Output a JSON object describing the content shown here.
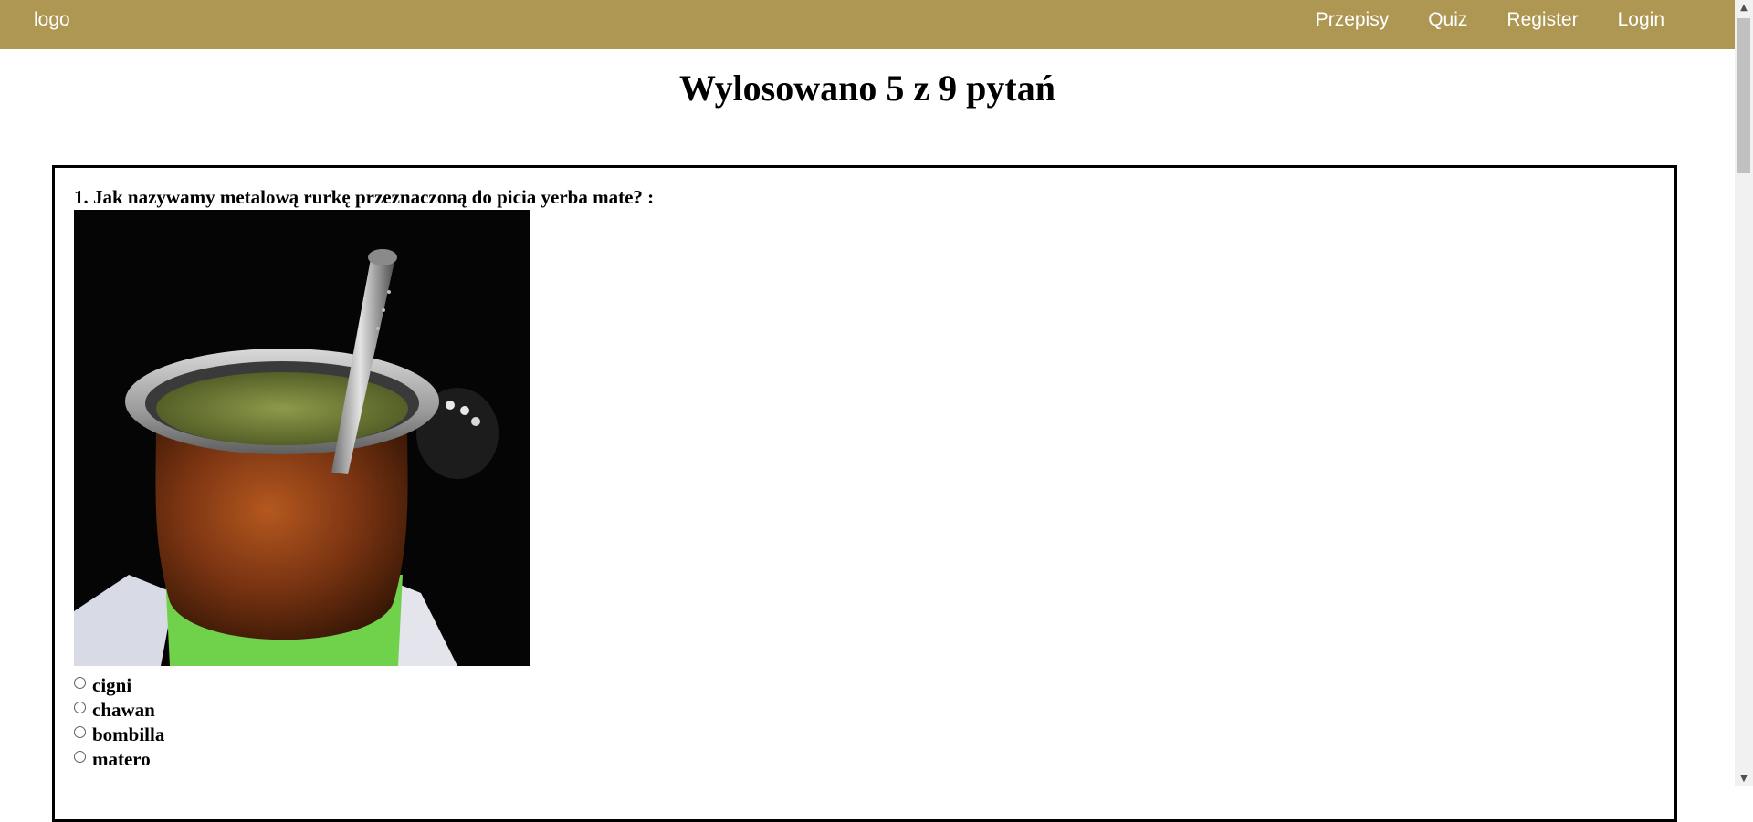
{
  "navbar": {
    "logo": "logo",
    "links": [
      "Przepisy",
      "Quiz",
      "Register",
      "Login"
    ],
    "background_color": "#ad9753"
  },
  "page_title": "Wylosowano 5 z 9 pytań",
  "quiz": {
    "question": "1. Jak nazywamy metalową rurkę przeznaczoną do picia yerba mate? :",
    "answers": [
      "cigni",
      "chawan",
      "bombilla",
      "matero"
    ]
  }
}
